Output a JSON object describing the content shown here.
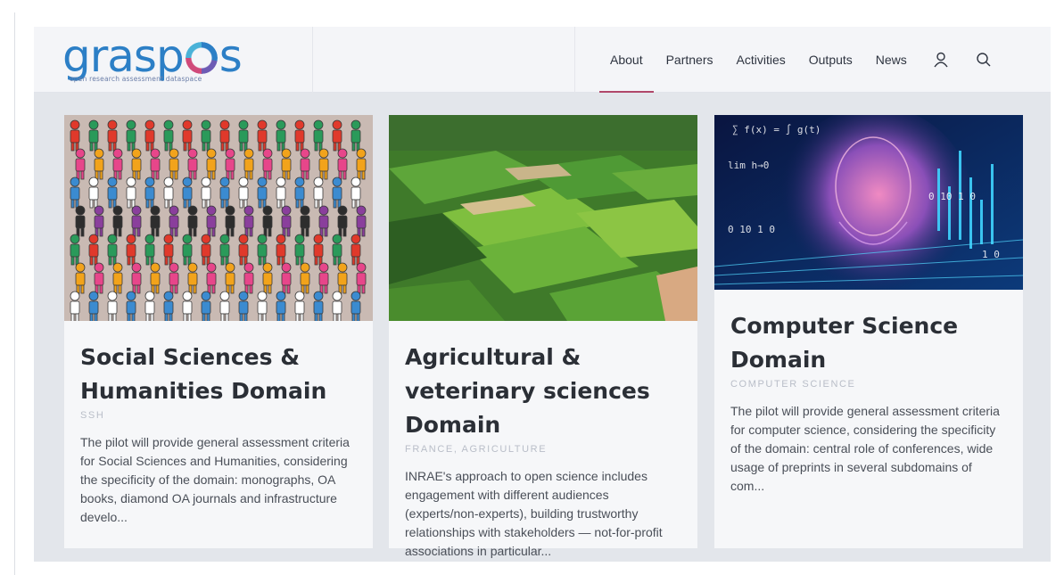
{
  "logo": {
    "word_left": "grasp",
    "word_right": "s",
    "tagline": "open research assessment dataspace"
  },
  "nav": {
    "items": [
      {
        "label": "About",
        "active": true
      },
      {
        "label": "Partners",
        "active": false
      },
      {
        "label": "Activities",
        "active": false
      },
      {
        "label": "Outputs",
        "active": false
      },
      {
        "label": "News",
        "active": false
      }
    ],
    "icons": [
      "user-icon",
      "search-icon"
    ],
    "active_color": "#b0476a"
  },
  "cards": [
    {
      "title": "Social Sciences & Humanities Domain",
      "tags": "SSH",
      "text": "The pilot will provide general assessment criteria for Social Sciences and Humanities, considering the specificity of the domain: monographs, OA books, diamond OA journals and infrastructure develo..."
    },
    {
      "title": "Agricultural & veterinary sciences Domain",
      "tags": "FRANCE, AGRICULTURE",
      "text": "INRAE's approach to open science includes engagement with different audiences (experts/non-experts), building trustworthy relationships with stakeholders — not-for-profit associations in particular..."
    },
    {
      "title": "Computer Science Domain",
      "tags": "COMPUTER SCIENCE",
      "text": "The pilot will provide general assessment criteria for computer science, considering the specificity of the domain: central role of conferences, wide usage of preprints in several subdomains of com..."
    }
  ]
}
